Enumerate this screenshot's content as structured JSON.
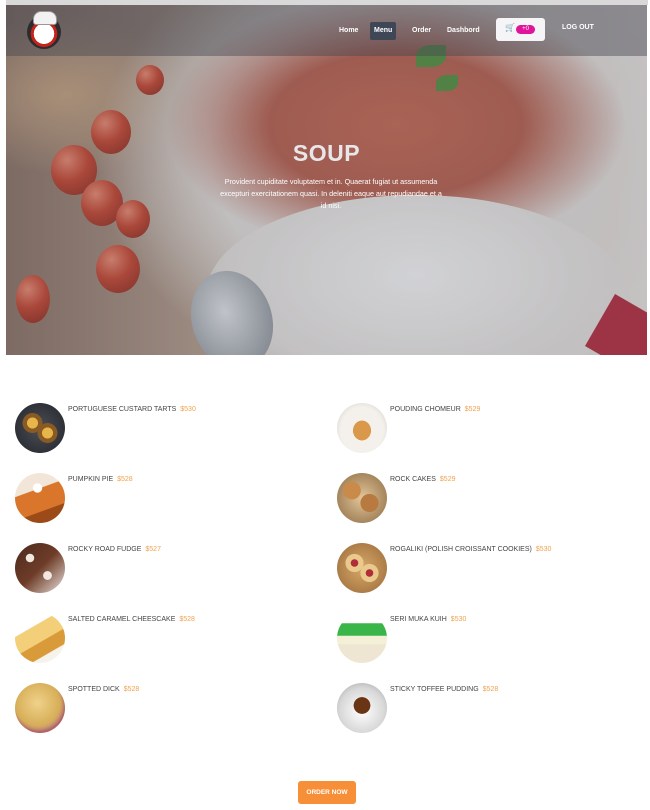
{
  "nav": {
    "links": [
      {
        "label": "Home",
        "active": false
      },
      {
        "label": "Menu",
        "active": true
      },
      {
        "label": "Order",
        "active": false
      },
      {
        "label": "Dashbord",
        "active": false
      }
    ],
    "cart_count": "+0",
    "cart_icon": "cart-icon",
    "logout_label": "LOG OUT"
  },
  "hero": {
    "title": "SOUP",
    "description": "Provident cupiditate voluptatem et in. Quaerat fugiat ut assumenda excepturi exercitationem quasi. In deleniti eaque aut repudiandae et a id nisi."
  },
  "menu": {
    "items": [
      {
        "name": "PORTUGUESE CUSTARD TARTS",
        "price": "$530"
      },
      {
        "name": "POUDING CHOMEUR",
        "price": "$529"
      },
      {
        "name": "PUMPKIN PIE",
        "price": "$528"
      },
      {
        "name": "ROCK CAKES",
        "price": "$529"
      },
      {
        "name": "ROCKY ROAD FUDGE",
        "price": "$527"
      },
      {
        "name": "ROGALIKI (POLISH CROISSANT COOKIES)",
        "price": "$530"
      },
      {
        "name": "SALTED CARAMEL CHEESCAKE",
        "price": "$528"
      },
      {
        "name": "SERI MUKA KUIH",
        "price": "$530"
      },
      {
        "name": "SPOTTED DICK",
        "price": "$528"
      },
      {
        "name": "STICKY TOFFEE PUDDING",
        "price": "$528"
      }
    ]
  },
  "order_button": "ORDER NOW",
  "colors": {
    "accent": "#f78f39",
    "price": "#f0a24e",
    "badge": "#e0149a",
    "nav_active": "#3f4656"
  }
}
